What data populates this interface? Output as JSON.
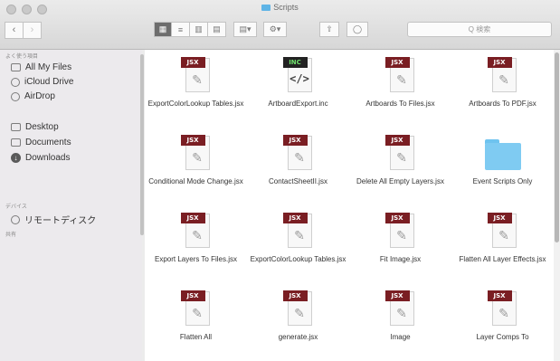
{
  "window": {
    "title": "Scripts"
  },
  "toolbar": {
    "back": "‹",
    "forward": "›",
    "view_buttons": [
      "▦",
      "≡",
      "▥",
      "▤"
    ],
    "arrange_label": "▤▾",
    "action_label": "⚙▾",
    "share_label": "⇧",
    "tag_label": "◯",
    "search_placeholder": "Q 検索"
  },
  "sidebar": {
    "favorites_header": "よく使う項目",
    "favorites": [
      {
        "label": "All My Files",
        "icon": "all-files-icon"
      },
      {
        "label": "iCloud Drive",
        "icon": "cloud-icon"
      },
      {
        "label": "AirDrop",
        "icon": "airdrop-icon"
      },
      {
        "label": "Desktop",
        "icon": "desktop-icon"
      },
      {
        "label": "Documents",
        "icon": "documents-icon"
      },
      {
        "label": "Downloads",
        "icon": "downloads-icon"
      }
    ],
    "devices_header": "デバイス",
    "devices": [
      {
        "label": "リモートディスク",
        "icon": "remote-disc-icon"
      }
    ],
    "shared_header": "共有"
  },
  "files": [
    {
      "name": "ExportColorLookup Tables.jsx",
      "badge": "JSX",
      "type": "jsx"
    },
    {
      "name": "ArtboardExport.inc",
      "badge": "INC",
      "type": "inc"
    },
    {
      "name": "Artboards To Files.jsx",
      "badge": "JSX",
      "type": "jsx"
    },
    {
      "name": "Artboards To PDF.jsx",
      "badge": "JSX",
      "type": "jsx"
    },
    {
      "name": "Conditional Mode Change.jsx",
      "badge": "JSX",
      "type": "jsx"
    },
    {
      "name": "ContactSheetII.jsx",
      "badge": "JSX",
      "type": "jsx"
    },
    {
      "name": "Delete All Empty Layers.jsx",
      "badge": "JSX",
      "type": "jsx"
    },
    {
      "name": "Event Scripts Only",
      "badge": "",
      "type": "folder"
    },
    {
      "name": "Export Layers To Files.jsx",
      "badge": "JSX",
      "type": "jsx"
    },
    {
      "name": "ExportColorLookup Tables.jsx",
      "badge": "JSX",
      "type": "jsx"
    },
    {
      "name": "Fit Image.jsx",
      "badge": "JSX",
      "type": "jsx"
    },
    {
      "name": "Flatten All Layer Effects.jsx",
      "badge": "JSX",
      "type": "jsx"
    },
    {
      "name": "Flatten All",
      "badge": "JSX",
      "type": "jsx"
    },
    {
      "name": "generate.jsx",
      "badge": "JSX",
      "type": "jsx"
    },
    {
      "name": "Image",
      "badge": "JSX",
      "type": "jsx"
    },
    {
      "name": "Layer Comps To",
      "badge": "JSX",
      "type": "jsx"
    }
  ],
  "colors": {
    "jsx_badge": "#7a1e23",
    "inc_badge": "#222222",
    "folder": "#7fcbf2",
    "sidebar_bg": "#eceaed"
  }
}
